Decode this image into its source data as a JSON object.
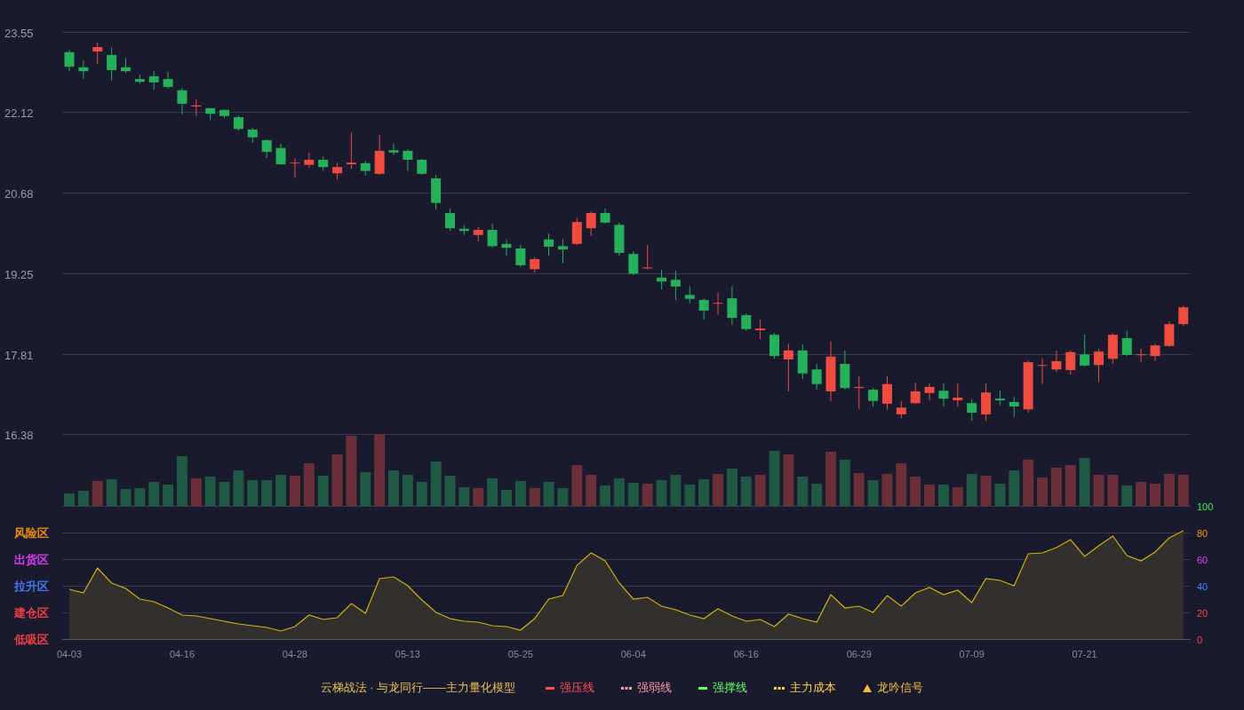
{
  "price_chart": {
    "chart_data": {
      "type": "candlestick",
      "ylim": [
        16.38,
        23.55
      ],
      "yticks": [
        23.55,
        22.12,
        20.68,
        19.25,
        17.81,
        16.38
      ],
      "grid": true,
      "ohlc": [
        [
          23.19,
          23.23,
          22.85,
          22.93
        ],
        [
          22.92,
          23.04,
          22.71,
          22.85
        ],
        [
          23.2,
          23.36,
          22.98,
          23.28
        ],
        [
          23.14,
          23.27,
          22.68,
          22.87
        ],
        [
          22.92,
          23.08,
          22.82,
          22.85
        ],
        [
          22.71,
          22.79,
          22.63,
          22.66
        ],
        [
          22.76,
          22.85,
          22.52,
          22.65
        ],
        [
          22.71,
          22.84,
          22.54,
          22.57
        ],
        [
          22.51,
          22.55,
          22.08,
          22.27
        ],
        [
          22.22,
          22.35,
          22.05,
          22.24
        ],
        [
          22.19,
          22.2,
          21.98,
          22.09
        ],
        [
          22.16,
          22.17,
          22.01,
          22.05
        ],
        [
          22.03,
          22.06,
          21.79,
          21.82
        ],
        [
          21.81,
          21.84,
          21.57,
          21.67
        ],
        [
          21.62,
          21.63,
          21.3,
          21.41
        ],
        [
          21.48,
          21.56,
          21.18,
          21.19
        ],
        [
          21.21,
          21.3,
          20.95,
          21.22
        ],
        [
          21.18,
          21.4,
          21.13,
          21.27
        ],
        [
          21.27,
          21.33,
          21.07,
          21.14
        ],
        [
          21.03,
          21.22,
          20.92,
          21.14
        ],
        [
          21.19,
          21.75,
          21.11,
          21.22
        ],
        [
          21.21,
          21.25,
          20.99,
          21.07
        ],
        [
          21.02,
          21.71,
          21.0,
          21.43
        ],
        [
          21.44,
          21.56,
          21.35,
          21.4
        ],
        [
          21.43,
          21.46,
          21.07,
          21.27
        ],
        [
          21.27,
          21.29,
          21.0,
          21.02
        ],
        [
          20.94,
          21.0,
          20.38,
          20.5
        ],
        [
          20.32,
          20.4,
          20.0,
          20.05
        ],
        [
          20.04,
          20.1,
          19.93,
          20.0
        ],
        [
          19.93,
          20.07,
          19.81,
          20.02
        ],
        [
          20.02,
          20.13,
          19.7,
          19.73
        ],
        [
          19.77,
          19.85,
          19.56,
          19.7
        ],
        [
          19.69,
          19.75,
          19.36,
          19.39
        ],
        [
          19.32,
          19.53,
          19.26,
          19.5
        ],
        [
          19.85,
          19.96,
          19.56,
          19.72
        ],
        [
          19.73,
          19.85,
          19.42,
          19.67
        ],
        [
          19.77,
          20.23,
          19.75,
          20.16
        ],
        [
          20.05,
          20.35,
          19.91,
          20.32
        ],
        [
          20.32,
          20.4,
          20.13,
          20.15
        ],
        [
          20.11,
          20.15,
          19.56,
          19.61
        ],
        [
          19.59,
          19.64,
          19.21,
          19.24
        ],
        [
          19.34,
          19.75,
          19.32,
          19.35
        ],
        [
          19.17,
          19.31,
          18.96,
          19.1
        ],
        [
          19.13,
          19.29,
          18.77,
          19.01
        ],
        [
          18.86,
          19.02,
          18.71,
          18.79
        ],
        [
          18.77,
          18.8,
          18.42,
          18.58
        ],
        [
          18.71,
          18.9,
          18.5,
          18.72
        ],
        [
          18.8,
          19.01,
          18.33,
          18.45
        ],
        [
          18.5,
          18.53,
          18.22,
          18.25
        ],
        [
          18.23,
          18.42,
          18.07,
          18.26
        ],
        [
          18.15,
          18.18,
          17.72,
          17.77
        ],
        [
          17.71,
          17.99,
          17.14,
          17.87
        ],
        [
          17.87,
          17.98,
          17.36,
          17.46
        ],
        [
          17.53,
          17.63,
          17.17,
          17.27
        ],
        [
          17.14,
          18.03,
          16.97,
          17.76
        ],
        [
          17.63,
          17.87,
          17.17,
          17.2
        ],
        [
          17.2,
          17.41,
          16.82,
          17.22
        ],
        [
          17.17,
          17.2,
          16.87,
          16.97
        ],
        [
          16.92,
          17.41,
          16.81,
          17.27
        ],
        [
          16.73,
          16.97,
          16.66,
          16.85
        ],
        [
          16.93,
          17.3,
          16.92,
          17.14
        ],
        [
          17.11,
          17.28,
          16.98,
          17.22
        ],
        [
          17.15,
          17.28,
          16.87,
          17.01
        ],
        [
          16.98,
          17.28,
          16.87,
          17.03
        ],
        [
          16.93,
          17.0,
          16.62,
          16.76
        ],
        [
          16.73,
          17.28,
          16.62,
          17.12
        ],
        [
          17.01,
          17.15,
          16.89,
          16.98
        ],
        [
          16.95,
          17.04,
          16.68,
          16.87
        ],
        [
          16.82,
          17.69,
          16.76,
          17.66
        ],
        [
          17.6,
          17.72,
          17.27,
          17.61
        ],
        [
          17.53,
          17.87,
          17.49,
          17.68
        ],
        [
          17.52,
          17.87,
          17.44,
          17.84
        ],
        [
          17.8,
          18.15,
          17.58,
          17.6
        ],
        [
          17.61,
          17.9,
          17.31,
          17.85
        ],
        [
          17.72,
          18.18,
          17.63,
          18.15
        ],
        [
          18.09,
          18.22,
          17.77,
          17.79
        ],
        [
          17.79,
          17.9,
          17.66,
          17.8
        ],
        [
          17.77,
          17.99,
          17.68,
          17.96
        ],
        [
          17.95,
          18.39,
          17.93,
          18.34
        ],
        [
          18.34,
          18.67,
          18.31,
          18.64
        ]
      ]
    }
  },
  "indicator_chart": {
    "zones": [
      {
        "label": "风险区",
        "color": "#ff9900"
      },
      {
        "label": "出货区",
        "color": "#e040fb"
      },
      {
        "label": "拉升区",
        "color": "#4a80ff"
      },
      {
        "label": "建仓区",
        "color": "#ff4444"
      },
      {
        "label": "低吸区",
        "color": "#ff4444"
      }
    ],
    "chart_data": {
      "type": "area",
      "ylim": [
        0,
        100
      ],
      "grid": true,
      "yticks": [
        100,
        80,
        60,
        40,
        20,
        0
      ],
      "categories": [
        "04-03",
        null,
        null,
        null,
        null,
        null,
        null,
        null,
        "04-16",
        null,
        null,
        null,
        null,
        null,
        null,
        null,
        "04-28",
        null,
        null,
        null,
        null,
        null,
        null,
        null,
        "05-13",
        null,
        null,
        null,
        null,
        null,
        null,
        null,
        "05-25",
        null,
        null,
        null,
        null,
        null,
        null,
        null,
        "06-04",
        null,
        null,
        null,
        null,
        null,
        null,
        null,
        "06-16",
        null,
        null,
        null,
        null,
        null,
        null,
        null,
        "06-29",
        null,
        null,
        null,
        null,
        null,
        null,
        null,
        "07-09",
        null,
        null,
        null,
        null,
        null,
        null,
        null,
        "07-21",
        null,
        null,
        null,
        null,
        null,
        null,
        null
      ],
      "series": [
        {
          "color": "#d4b10e",
          "values": [
            37.3,
            34.7,
            53.3,
            42.0,
            38.0,
            30.0,
            28.0,
            23.3,
            18.0,
            17.3,
            15.3,
            13.3,
            11.3,
            10.0,
            8.7,
            6.0,
            9.3,
            18.0,
            14.7,
            16.0,
            26.7,
            19.3,
            45.3,
            46.7,
            40.0,
            29.3,
            20.0,
            15.3,
            13.3,
            12.7,
            10.0,
            9.3,
            6.7,
            15.3,
            30.0,
            32.7,
            55.3,
            64.7,
            58.7,
            42.0,
            30.0,
            31.3,
            24.7,
            22.0,
            18.0,
            15.3,
            22.7,
            17.3,
            13.3,
            14.7,
            9.3,
            18.7,
            15.3,
            12.7,
            33.3,
            23.3,
            24.7,
            20.0,
            32.7,
            24.7,
            34.7,
            38.7,
            33.3,
            36.7,
            27.3,
            45.3,
            44.0,
            40.0,
            64.0,
            64.7,
            68.7,
            74.7,
            62.0,
            70.0,
            77.3,
            62.7,
            58.7,
            65.3,
            76.0,
            81.3
          ]
        }
      ]
    }
  },
  "legend": {
    "title": "云梯战法 · 与龙同行——主力量化模型",
    "items": [
      {
        "kind": "solid",
        "color": "#ff4d4d",
        "label": "强压线"
      },
      {
        "kind": "dashed",
        "color": "#ff9aa8",
        "label": "强弱线"
      },
      {
        "kind": "solid",
        "color": "#66ff66",
        "label": "强撑线"
      },
      {
        "kind": "dashed",
        "color": "#ffd23c",
        "label": "主力成本"
      },
      {
        "kind": "triangle",
        "color": "#f0c040",
        "label": "龙吟信号"
      }
    ]
  }
}
